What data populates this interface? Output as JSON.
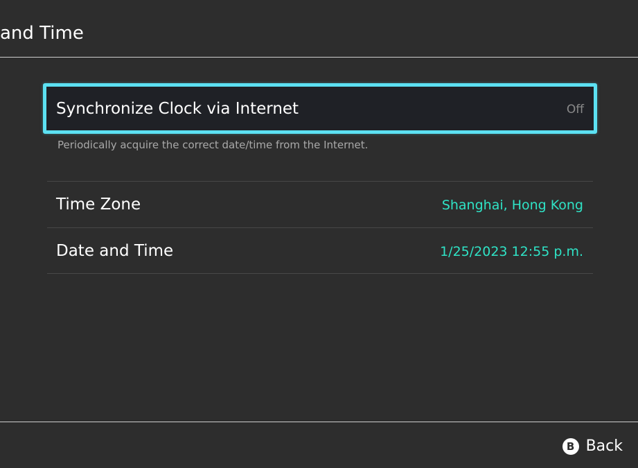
{
  "header": {
    "title": "and Time"
  },
  "settings": {
    "sync": {
      "label": "Synchronize Clock via Internet",
      "value": "Off",
      "description": "Periodically acquire the correct date/time from the Internet."
    },
    "items": [
      {
        "label": "Time Zone",
        "value": "Shanghai, Hong Kong"
      },
      {
        "label": "Date and Time",
        "value": "1/25/2023 12:55 p.m."
      }
    ]
  },
  "footer": {
    "back_button_glyph": "B",
    "back_label": "Back"
  },
  "colors": {
    "background": "#2d2d2d",
    "focus_border": "#5ce1f2",
    "value_accent": "#2fe3c6",
    "muted_text": "#8a8a8a"
  },
  "icons": {
    "back": "b-button-icon"
  }
}
